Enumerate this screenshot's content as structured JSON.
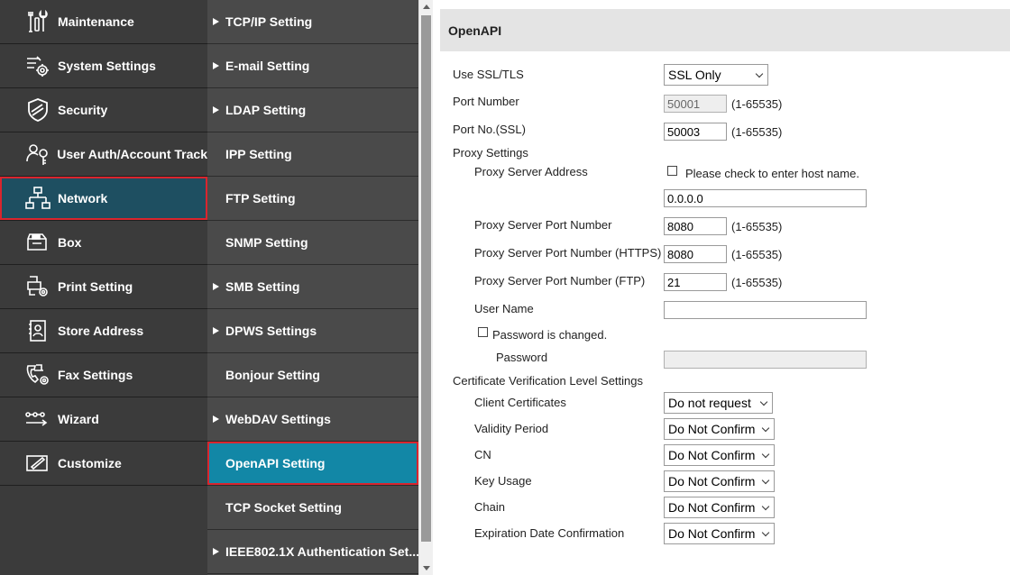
{
  "sidebar": {
    "items": [
      {
        "label": "Maintenance",
        "icon": "maintenance-tools-icon"
      },
      {
        "label": "System Settings",
        "icon": "system-settings-gear-icon"
      },
      {
        "label": "Security",
        "icon": "shield-icon"
      },
      {
        "label": "User Auth/Account Track",
        "icon": "user-key-icon"
      },
      {
        "label": "Network",
        "icon": "network-icon"
      },
      {
        "label": "Box",
        "icon": "box-icon"
      },
      {
        "label": "Print Setting",
        "icon": "print-settings-icon"
      },
      {
        "label": "Store Address",
        "icon": "address-book-icon"
      },
      {
        "label": "Fax Settings",
        "icon": "fax-settings-icon"
      },
      {
        "label": "Wizard",
        "icon": "wizard-icon"
      },
      {
        "label": "Customize",
        "icon": "customize-icon"
      }
    ]
  },
  "submenu": {
    "items": [
      {
        "label": "TCP/IP Setting",
        "expandable": true
      },
      {
        "label": "E-mail Setting",
        "expandable": true
      },
      {
        "label": "LDAP Setting",
        "expandable": true
      },
      {
        "label": "IPP Setting",
        "expandable": false
      },
      {
        "label": "FTP Setting",
        "expandable": false
      },
      {
        "label": "SNMP Setting",
        "expandable": false
      },
      {
        "label": "SMB Setting",
        "expandable": true
      },
      {
        "label": "DPWS Settings",
        "expandable": true
      },
      {
        "label": "Bonjour Setting",
        "expandable": false
      },
      {
        "label": "WebDAV Settings",
        "expandable": true
      },
      {
        "label": "OpenAPI Setting",
        "expandable": false
      },
      {
        "label": "TCP Socket Setting",
        "expandable": false
      },
      {
        "label": "IEEE802.1X Authentication Set...",
        "expandable": true
      }
    ]
  },
  "colors": {
    "sidebar_bg": "#3b3b3b",
    "submenu_bg": "#4a4a4a",
    "active_nav_bg": "#1e4f61",
    "active_sub_bg": "#1287a6",
    "highlight_border": "#d9252e"
  },
  "content": {
    "title": "OpenAPI",
    "use_ssl": {
      "label": "Use SSL/TLS",
      "value": "SSL Only"
    },
    "port": {
      "label": "Port Number",
      "value": "50001",
      "range": "(1-65535)"
    },
    "port_ssl": {
      "label": "Port No.(SSL)",
      "value": "50003",
      "range": "(1-65535)"
    },
    "proxy": {
      "section_label": "Proxy Settings",
      "address_label": "Proxy Server Address",
      "hostname_check_label": "Please check to enter host name.",
      "address_value": "0.0.0.0",
      "port_label": "Proxy Server Port Number",
      "port_value": "8080",
      "port_range": "(1-65535)",
      "port_https_label": "Proxy Server Port Number (HTTPS)",
      "port_https_value": "8080",
      "port_https_range": "(1-65535)",
      "port_ftp_label": "Proxy Server Port Number (FTP)",
      "port_ftp_value": "21",
      "port_ftp_range": "(1-65535)",
      "username_label": "User Name",
      "username_value": "",
      "password_changed_label": "Password is changed.",
      "password_label": "Password",
      "password_value": ""
    },
    "cert": {
      "section_label": "Certificate Verification Level Settings",
      "rows": [
        {
          "label": "Client Certificates",
          "value": "Do not request"
        },
        {
          "label": "Validity Period",
          "value": "Do Not Confirm"
        },
        {
          "label": "CN",
          "value": "Do Not Confirm"
        },
        {
          "label": "Key Usage",
          "value": "Do Not Confirm"
        },
        {
          "label": "Chain",
          "value": "Do Not Confirm"
        },
        {
          "label": "Expiration Date Confirmation",
          "value": "Do Not Confirm"
        }
      ]
    }
  }
}
